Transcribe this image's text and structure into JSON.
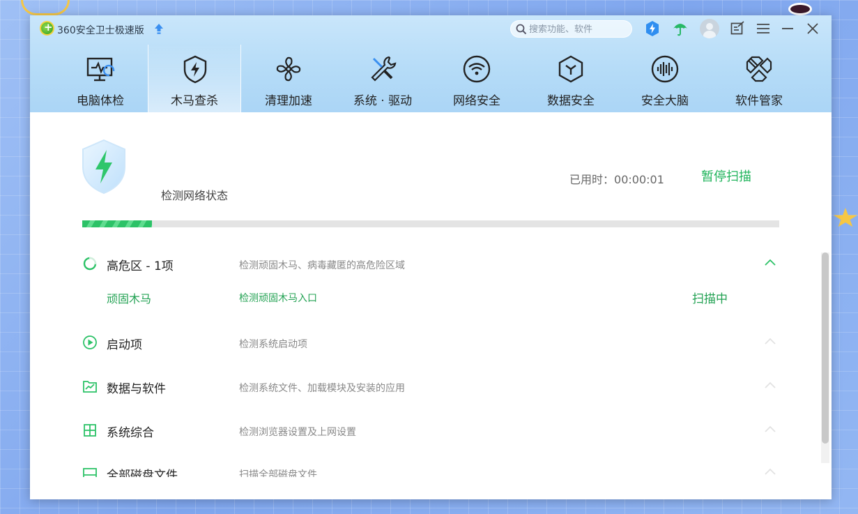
{
  "window": {
    "title": "360安全卫士极速版",
    "search_placeholder": "搜索功能、软件"
  },
  "toolbar_icons": [
    "speed-boost-icon",
    "umbrella-icon",
    "avatar",
    "feedback-icon",
    "menu-icon",
    "minimize-icon",
    "close-icon"
  ],
  "nav": [
    {
      "label": "电脑体检",
      "icon": "monitor-checkup-icon",
      "active": false
    },
    {
      "label": "木马查杀",
      "icon": "shield-bolt-icon",
      "active": true
    },
    {
      "label": "清理加速",
      "icon": "fan-icon",
      "active": false
    },
    {
      "label": "系统 · 驱动",
      "icon": "tools-icon",
      "active": false
    },
    {
      "label": "网络安全",
      "icon": "wifi-icon",
      "active": false
    },
    {
      "label": "数据安全",
      "icon": "cube-icon",
      "active": false
    },
    {
      "label": "安全大脑",
      "icon": "brain-wave-icon",
      "active": false
    },
    {
      "label": "软件管家",
      "icon": "apps-icon",
      "active": false
    }
  ],
  "scan": {
    "status": "检测网络状态",
    "elapsed_label": "已用时：",
    "elapsed_value": "00:00:01",
    "pause_label": "暂停扫描",
    "progress": 0.1
  },
  "categories": [
    {
      "name": "高危区 -  1项",
      "desc": "检测顽固木马、病毒藏匿的高危险区域",
      "icon": "spinner-icon",
      "expanded": true,
      "items": [
        {
          "name": "顽固木马",
          "desc": "检测顽固木马入口",
          "status": "扫描中"
        }
      ]
    },
    {
      "name": "启动项",
      "desc": "检测系统启动项",
      "icon": "play-circle-icon",
      "expanded": false
    },
    {
      "name": "数据与软件",
      "desc": "检测系统文件、加载模块及安装的应用",
      "icon": "folder-chart-icon",
      "expanded": false
    },
    {
      "name": "系统综合",
      "desc": "检测浏览器设置及上网设置",
      "icon": "windows-icon",
      "expanded": false
    },
    {
      "name": "全部磁盘文件",
      "desc": "扫描全部磁盘文件",
      "icon": "disk-icon",
      "expanded": false
    }
  ],
  "colors": {
    "accent": "#21b45c",
    "header": "#b4dbf7"
  }
}
